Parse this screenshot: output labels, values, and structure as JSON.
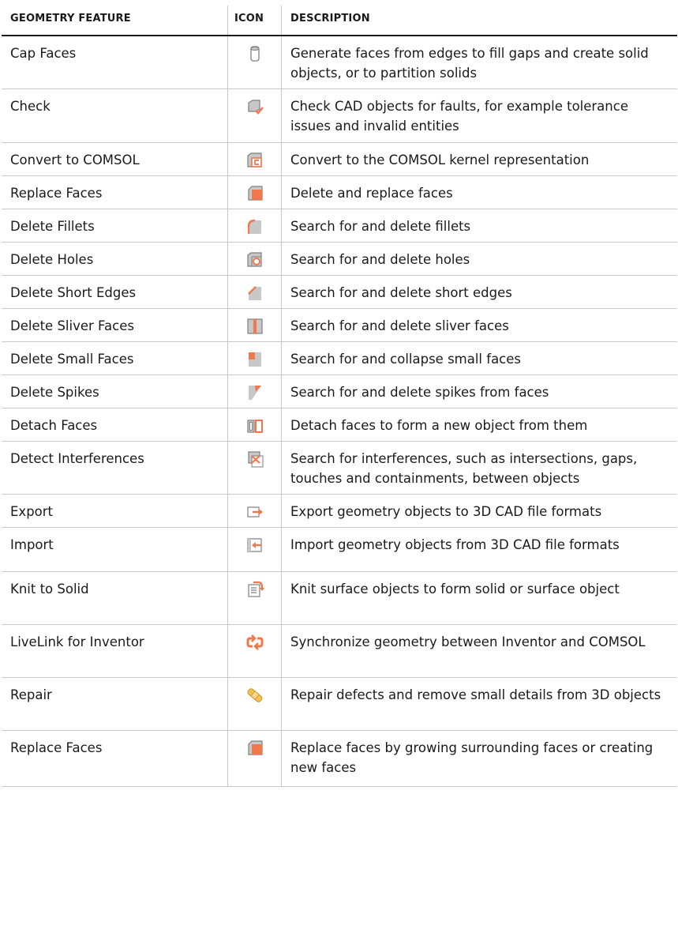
{
  "table": {
    "headers": [
      "GEOMETRY FEATURE",
      "ICON",
      "DESCRIPTION"
    ],
    "rows": [
      {
        "feature": "Cap Faces",
        "icon": "cap-faces-icon",
        "description": "Generate faces from edges to fill gaps and create solid objects, or to partition solids"
      },
      {
        "feature": "Check",
        "icon": "check-icon",
        "description": "Check CAD objects for faults, for example tolerance issues and invalid entities"
      },
      {
        "feature": "Convert to COMSOL",
        "icon": "convert-to-comsol-icon",
        "description": "Convert to the COMSOL kernel representation"
      },
      {
        "feature": "Replace Faces",
        "icon": "replace-faces-icon",
        "description": "Delete and replace faces"
      },
      {
        "feature": "Delete Fillets",
        "icon": "delete-fillets-icon",
        "description": "Search for and delete fillets"
      },
      {
        "feature": "Delete Holes",
        "icon": "delete-holes-icon",
        "description": "Search for and delete holes"
      },
      {
        "feature": "Delete Short Edges",
        "icon": "delete-short-edges-icon",
        "description": "Search for and delete short edges"
      },
      {
        "feature": "Delete Sliver Faces",
        "icon": "delete-sliver-faces-icon",
        "description": "Search for and delete sliver faces"
      },
      {
        "feature": "Delete Small Faces",
        "icon": "delete-small-faces-icon",
        "description": "Search for and collapse small faces"
      },
      {
        "feature": "Delete Spikes",
        "icon": "delete-spikes-icon",
        "description": "Search for and delete spikes from faces"
      },
      {
        "feature": "Detach Faces",
        "icon": "detach-faces-icon",
        "description": "Detach faces to form a new object from them"
      },
      {
        "feature": "Detect Interferences",
        "icon": "detect-interferences-icon",
        "description": "Search for interferences, such as intersections, gaps, touches and containments, between objects"
      },
      {
        "feature": "Export",
        "icon": "export-icon",
        "description": "Export geometry objects to 3D CAD file formats"
      },
      {
        "feature": "Import",
        "icon": "import-icon",
        "description": "Import geometry objects from 3D CAD file formats"
      },
      {
        "feature": "Knit to Solid",
        "icon": "knit-to-solid-icon",
        "description": "Knit surface objects to form solid or surface object"
      },
      {
        "feature": "LiveLink for Inventor",
        "icon": "livelink-icon",
        "description": "Synchronize geometry between Inventor and COMSOL"
      },
      {
        "feature": "Repair",
        "icon": "repair-icon",
        "description": "Repair defects and remove small details from 3D objects"
      },
      {
        "feature": "Replace Faces",
        "icon": "replace-faces-icon",
        "description": "Replace faces by growing surrounding faces or creating new faces"
      }
    ]
  },
  "colors": {
    "accent": "#f0784a",
    "icon_gray": "#c8c8c8",
    "icon_outline": "#7f7f7f",
    "rule": "#c8c8c8"
  }
}
